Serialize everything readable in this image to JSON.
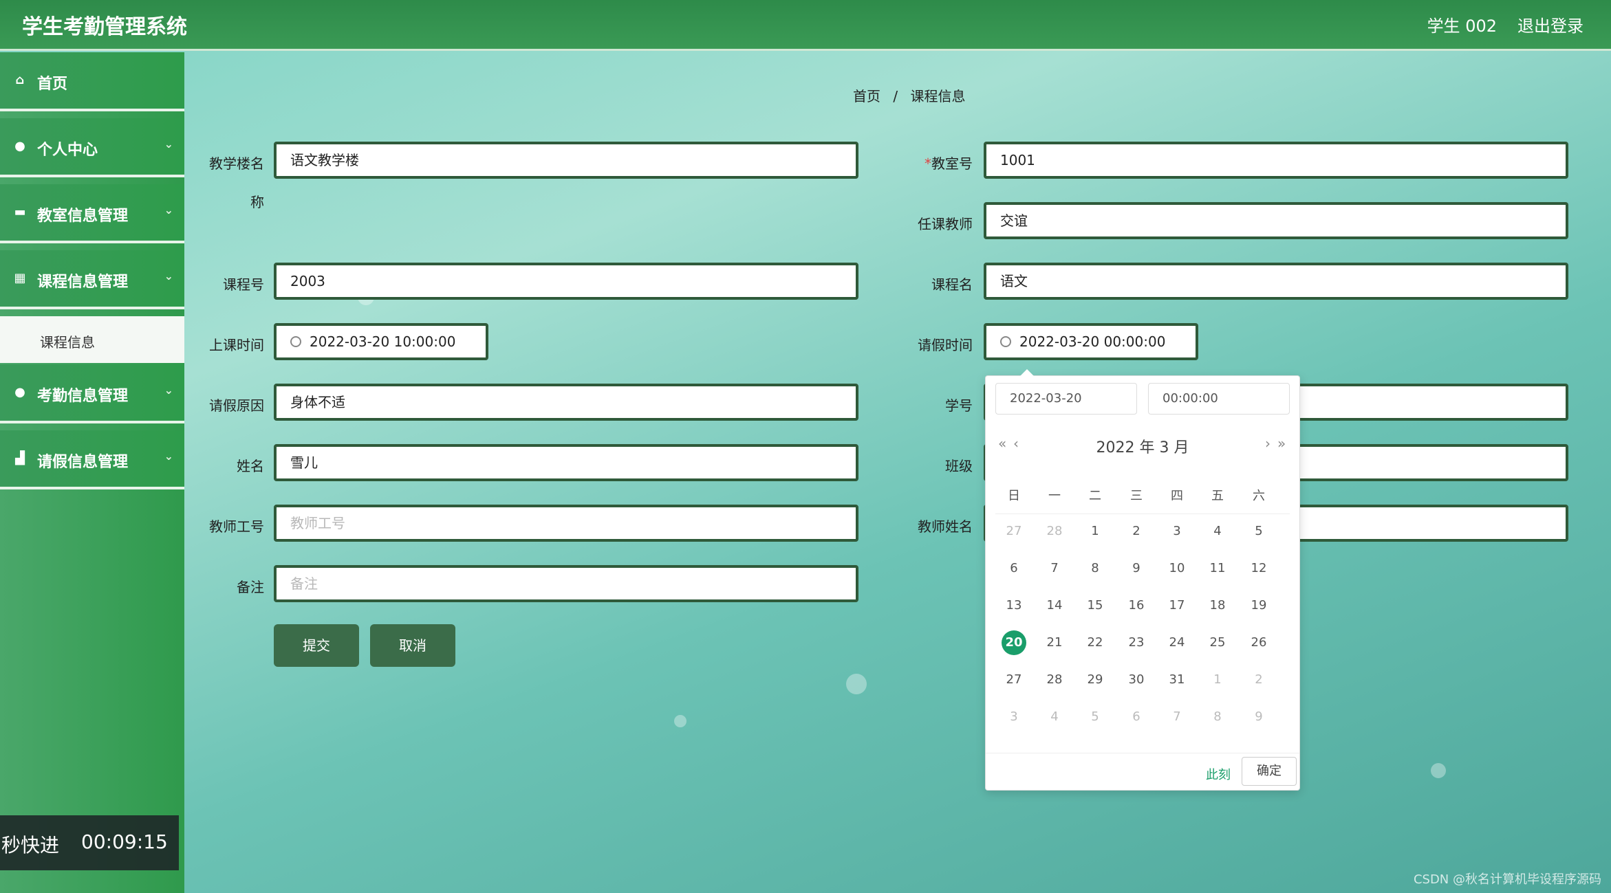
{
  "header": {
    "title": "学生考勤管理系统",
    "user": "学生 002",
    "logout": "退出登录"
  },
  "sidebar": {
    "items": [
      {
        "label": "首页",
        "icon": "home-icon"
      },
      {
        "label": "个人中心",
        "icon": "user-icon"
      },
      {
        "label": "教室信息管理",
        "icon": "classroom-icon"
      },
      {
        "label": "课程信息管理",
        "icon": "grid-icon"
      },
      {
        "label": "考勤信息管理",
        "icon": "location-icon"
      },
      {
        "label": "请假信息管理",
        "icon": "leave-icon"
      }
    ],
    "subitem": "课程信息"
  },
  "breadcrumb": {
    "home": "首页",
    "sep": "/",
    "current": "课程信息"
  },
  "form": {
    "building_label": "教学楼名",
    "building_label_tail": "称",
    "building_value": "语文教学楼",
    "room_label": "教室号",
    "room_star": "*",
    "room_value": "1001",
    "teacher_label": "任课教师",
    "teacher_value": "交谊",
    "course_no_label": "课程号",
    "course_no_value": "2003",
    "course_name_label": "课程名",
    "course_name_value": "语文",
    "class_time_label": "上课时间",
    "class_time_value": "2022-03-20 10:00:00",
    "leave_time_label": "请假时间",
    "leave_time_value": "2022-03-20 00:00:00",
    "reason_label": "请假原因",
    "reason_value": "身体不适",
    "student_no_label": "学号",
    "name_label": "姓名",
    "name_value": "雪儿",
    "class_label": "班级",
    "teacher_id_label": "教师工号",
    "teacher_id_placeholder": "教师工号",
    "teacher_name_label": "教师姓名",
    "remark_label": "备注",
    "remark_placeholder": "备注",
    "submit": "提交",
    "cancel": "取消"
  },
  "picker": {
    "date_input": "2022-03-20",
    "time_input": "00:00:00",
    "prev_year": "«",
    "prev_month": "‹",
    "next_month": "›",
    "next_year": "»",
    "header": "2022 年  3 月",
    "weekdays": [
      "日",
      "一",
      "二",
      "三",
      "四",
      "五",
      "六"
    ],
    "weeks": [
      [
        "27",
        "28",
        "1",
        "2",
        "3",
        "4",
        "5"
      ],
      [
        "6",
        "7",
        "8",
        "9",
        "10",
        "11",
        "12"
      ],
      [
        "13",
        "14",
        "15",
        "16",
        "17",
        "18",
        "19"
      ],
      [
        "20",
        "21",
        "22",
        "23",
        "24",
        "25",
        "26"
      ],
      [
        "27",
        "28",
        "29",
        "30",
        "31",
        "1",
        "2"
      ],
      [
        "3",
        "4",
        "5",
        "6",
        "7",
        "8",
        "9"
      ]
    ],
    "selected": "20",
    "now": "此刻",
    "confirm": "确定"
  },
  "overlay": {
    "speed": "秒快进",
    "time": "00:09:15"
  },
  "watermark": "CSDN @秋名计算机毕设程序源码"
}
